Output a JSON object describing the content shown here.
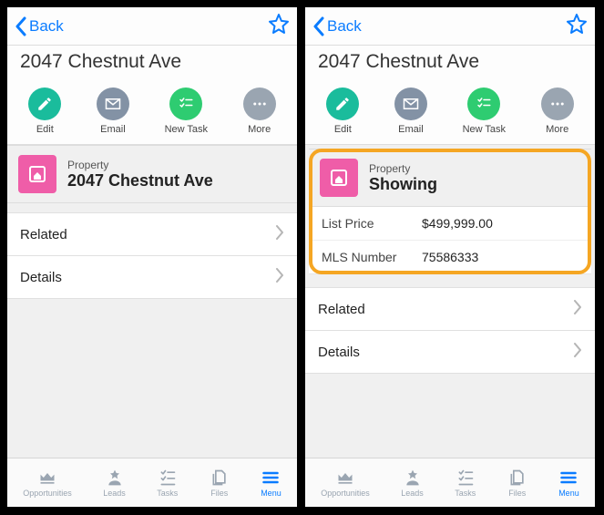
{
  "nav": {
    "back": "Back"
  },
  "title": "2047 Chestnut Ave",
  "actions": {
    "edit": "Edit",
    "email": "Email",
    "newtask": "New Task",
    "more": "More"
  },
  "card": {
    "label": "Property",
    "value_left": "2047 Chestnut Ave",
    "value_right": "Showing"
  },
  "fields": {
    "listprice_label": "List Price",
    "listprice_value": "$499,999.00",
    "mls_label": "MLS Number",
    "mls_value": "75586333"
  },
  "sections": {
    "related": "Related",
    "details": "Details"
  },
  "tabs": {
    "opportunities": "Opportunities",
    "leads": "Leads",
    "tasks": "Tasks",
    "files": "Files",
    "menu": "Menu"
  }
}
